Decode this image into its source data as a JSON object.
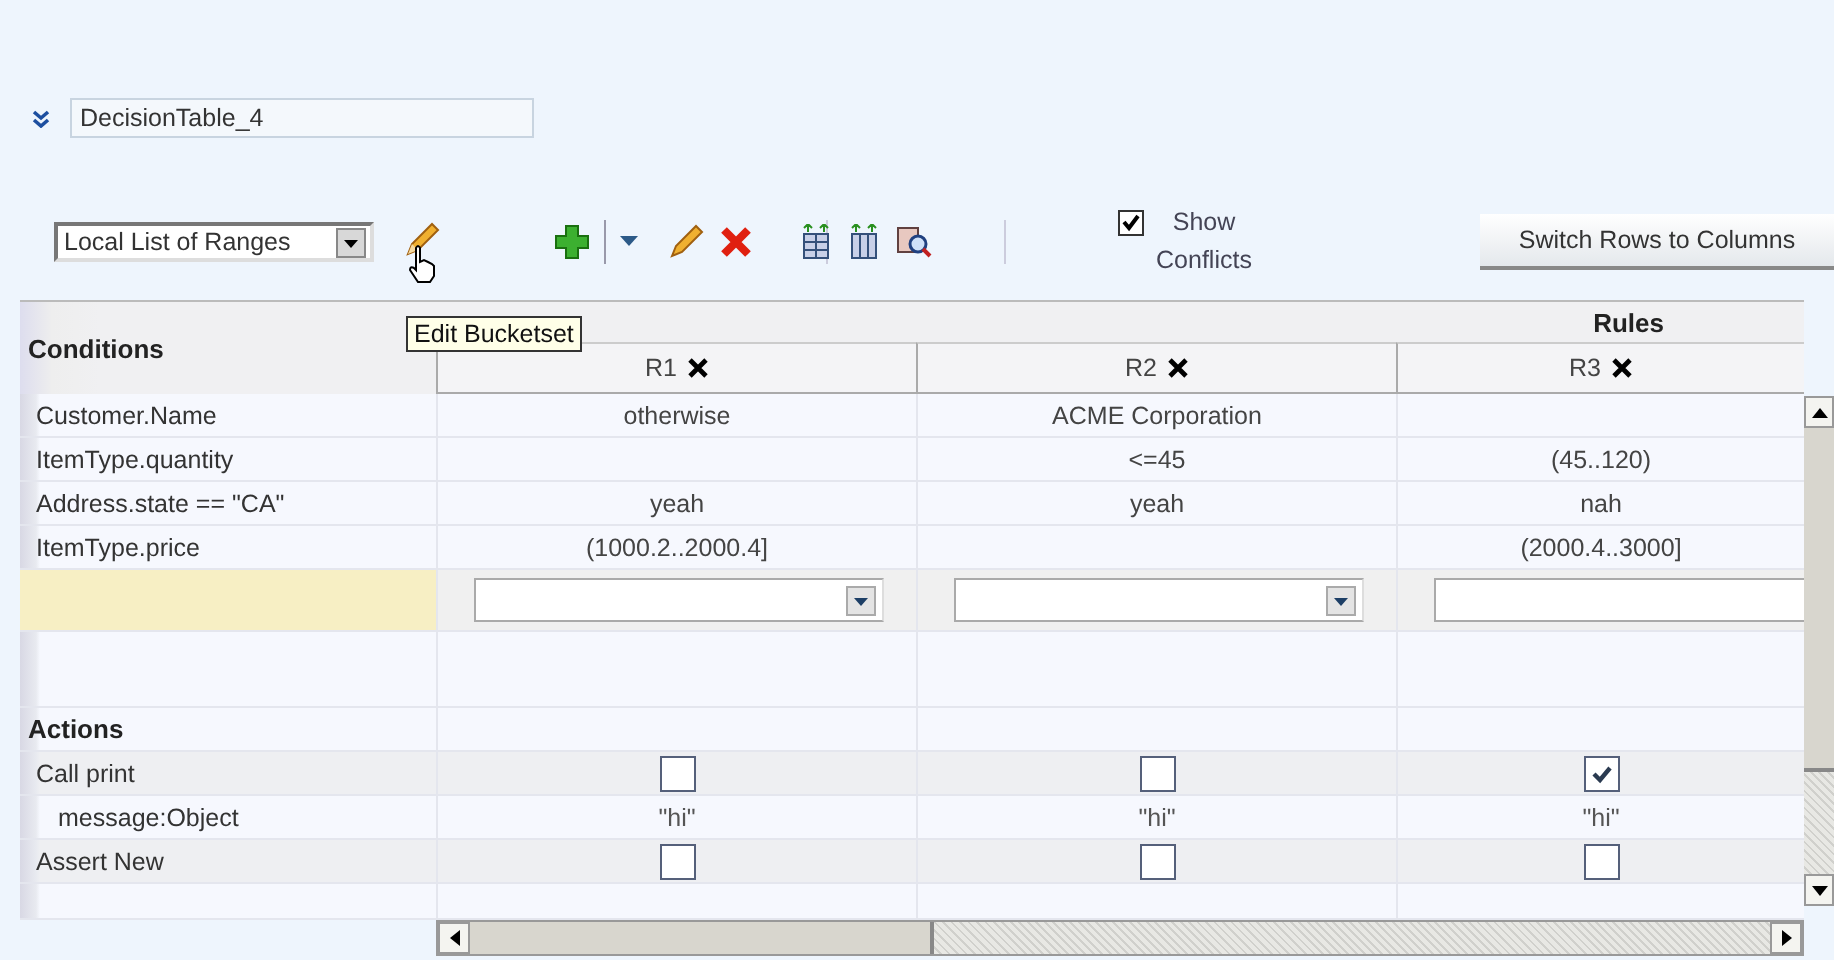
{
  "name_field": {
    "value": "DecisionTable_4"
  },
  "toolbar": {
    "bucketset_select": {
      "value": "Local List of Ranges"
    },
    "show_conflicts": {
      "label": "Show Conflicts",
      "checked": true
    },
    "switch_button": {
      "label": "Switch Rows to Columns"
    }
  },
  "tooltip": {
    "text": "Edit Bucketset"
  },
  "table": {
    "conditions_heading": "Conditions",
    "rules_heading": "Rules",
    "rules": [
      {
        "label": "R1"
      },
      {
        "label": "R2"
      },
      {
        "label": "R3"
      }
    ],
    "conditions": [
      {
        "label": "Customer.Name",
        "cells": [
          "otherwise",
          "ACME Corporation",
          null
        ]
      },
      {
        "label": "ItemType.quantity",
        "cells": [
          null,
          "<=45",
          "(45..120)"
        ]
      },
      {
        "label": "Address.state == \"CA\"",
        "cells": [
          "yeah",
          "yeah",
          "nah"
        ]
      },
      {
        "label": "ItemType.price",
        "cells": [
          "(1000.2..2000.4]",
          null,
          "(2000.4..3000]"
        ]
      }
    ],
    "actions_heading": "Actions",
    "actions": [
      {
        "label": "Call print",
        "kind": "checkbox",
        "cells": [
          {
            "checked": false
          },
          {
            "checked": false
          },
          {
            "checked": true
          }
        ],
        "children": [
          {
            "label": "message:Object",
            "kind": "value",
            "cells": [
              {
                "text": "\"hi\""
              },
              {
                "text": "\"hi\""
              },
              {
                "text": "\"hi\""
              }
            ]
          }
        ]
      },
      {
        "label": "Assert New",
        "kind": "checkbox",
        "cells": [
          {
            "checked": false
          },
          {
            "checked": false
          },
          {
            "checked": false
          }
        ]
      }
    ]
  }
}
